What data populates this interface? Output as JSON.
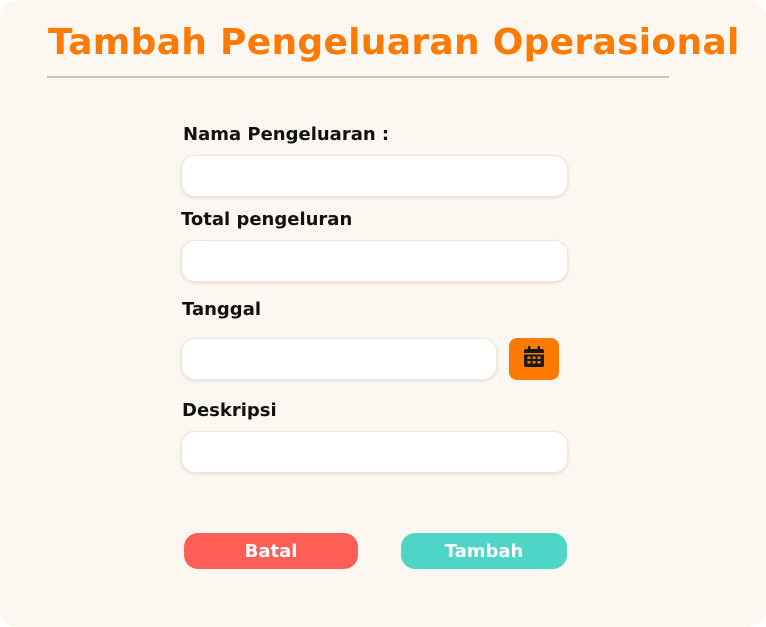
{
  "page": {
    "title": "Tambah Pengeluaran Operasional"
  },
  "form": {
    "name_label": "Nama Pengeluaran :",
    "name_value": "",
    "total_label": "Total pengeluran",
    "total_value": "",
    "date_label": "Tanggal",
    "date_value": "",
    "description_label": "Deskripsi",
    "description_value": ""
  },
  "icons": {
    "calendar": "calendar-icon"
  },
  "buttons": {
    "cancel_label": "Batal",
    "submit_label": "Tambah"
  },
  "colors": {
    "accent": "#ff7a00",
    "background": "#fdf7f1",
    "cancel": "#ff5f57",
    "submit": "#4dd6c6"
  }
}
